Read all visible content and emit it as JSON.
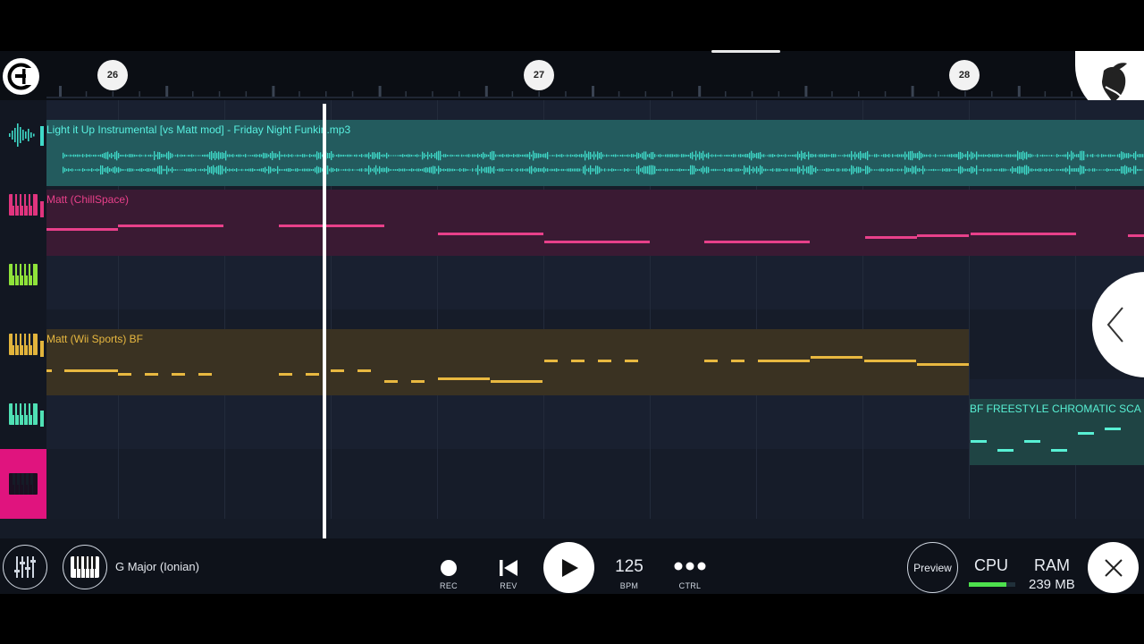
{
  "timeline": {
    "bar_markers": [
      "26",
      "27",
      "28"
    ]
  },
  "tracks": [
    {
      "icon": "waveform-icon",
      "color": "#3fd9c8",
      "clip": {
        "label": "Light it Up Instrumental [vs Matt mod] - Friday Night Funkin.mp3",
        "bg": "#235b5e",
        "text_color": "#58f0e0"
      }
    },
    {
      "icon": "piano-icon",
      "color": "#e0347e",
      "clip": {
        "label": "Matt (ChillSpace)",
        "bg": "#3a1a33",
        "text_color": "#e8408a",
        "note_color": "#e8408a"
      }
    },
    {
      "icon": "piano-icon",
      "color": "#8fe33a",
      "clip": null
    },
    {
      "icon": "piano-icon",
      "color": "#e2b43c",
      "clip": {
        "label": "Matt (Wii Sports) BF",
        "bg": "#3a3222",
        "text_color": "#e8b840",
        "note_color": "#e8b840"
      }
    },
    {
      "icon": "piano-icon",
      "color": "#4fe0b4",
      "clip": {
        "label": "BF FREESTYLE CHROMATIC SCA",
        "bg": "#1f4444",
        "text_color": "#58f0d4",
        "note_color": "#58f0d4"
      }
    },
    {
      "icon": "piano-icon",
      "color": "#e0147e",
      "selected": true,
      "clip": null
    }
  ],
  "bottom_bar": {
    "scale": "G Major (Ionian)",
    "rec_label": "REC",
    "rev_label": "REV",
    "bpm_value": "125",
    "bpm_label": "BPM",
    "ctrl_label": "CTRL",
    "preview_label": "Preview",
    "cpu_label": "CPU",
    "cpu_level": 0.8,
    "ram_label": "RAM",
    "ram_value": "239 MB"
  },
  "colors": {
    "accent": "#e0147e",
    "cpu_meter": "#4de04d"
  }
}
